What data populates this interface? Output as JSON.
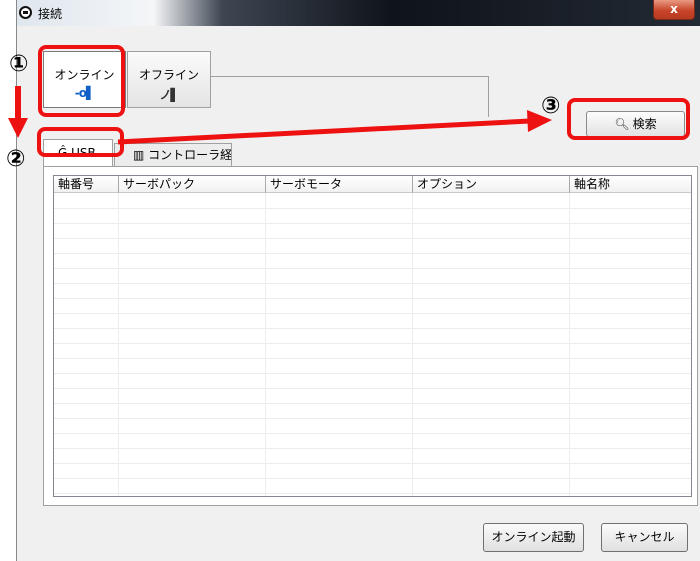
{
  "window": {
    "title": "接続",
    "close_label": "x"
  },
  "mode_tabs": [
    {
      "label": "オンライン",
      "icon": "plug-connected-icon",
      "glyph": "-o▌",
      "selected": true
    },
    {
      "label": "オフライン",
      "icon": "plug-disconnected-icon",
      "glyph": "ノ▌",
      "selected": false
    }
  ],
  "search_button": {
    "label": "検索",
    "icon": "magnifier-icon",
    "glyph": "🔍︎"
  },
  "connection_tabs": [
    {
      "label": "USB",
      "icon": "usb-icon",
      "glyph": "Ĝ",
      "selected": true
    },
    {
      "label": "コントローラ経由",
      "icon": "controller-icon",
      "glyph": "▥",
      "selected": false
    }
  ],
  "table": {
    "columns": [
      "軸番号",
      "サーボパック",
      "サーボモータ",
      "オプション",
      "軸名称"
    ],
    "rows": []
  },
  "footer": {
    "start_online_label": "オンライン起動",
    "cancel_label": "キャンセル"
  },
  "annotations": {
    "step1": "①",
    "step2": "②",
    "step3": "③",
    "color": "#ee1111"
  }
}
